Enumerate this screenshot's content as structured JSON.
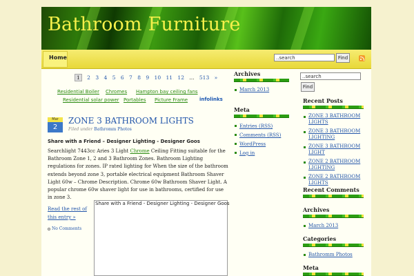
{
  "header": {
    "site_title": "Bathroom Furniture"
  },
  "nav": {
    "home": "Home",
    "search_value": "..search",
    "find_label": "Find"
  },
  "pager": [
    "1",
    "2",
    "3",
    "4",
    "5",
    "6",
    "7",
    "8",
    "9",
    "10",
    "11",
    "12",
    "...",
    "513",
    "»"
  ],
  "link_units": {
    "row1": [
      "Residential Boiler",
      "Chromes",
      "Hampton bay ceiling fans"
    ],
    "row2": [
      "Residential solar power",
      "Portables",
      "Picture Frame"
    ],
    "infolinks": "infolinks"
  },
  "post": {
    "date_month": "Mar",
    "date_day": "2",
    "title": "ZONE 3 BATHROOM LIGHTS",
    "filed_prefix": "Filed under",
    "category": "Bathromm Photos",
    "subhead": "Share with a Friend – Designer Lighting - Designer Goos",
    "body_before": "Searchlight 7443cc Aries 3 Light ",
    "body_link": "Chrome",
    "body_after": " Ceiling Fitting suitable for the Bathroom Zone 1, 2 and 3 Bathroom Zones. Bathroom Lighting regulations for zones. IP rated lighting for When the size of the bathroom extends beyond zone 3, portable electrical equipment Bathroom Shaver Light 60w – Chrome Description. Chrome 60w Bathroom Shaver Light. A popular chrome 60w shaver light for use in bathrooms, certified for use in zone 3.",
    "read_more": "Read the rest of this entry »",
    "comments": "No Comments",
    "frame_text": "Share with a Friend - Designer Lighting - Designer Goos"
  },
  "left_sidebar": {
    "archives_title": "Archives",
    "archives": [
      "March 2013"
    ],
    "meta_title": "Meta",
    "meta": [
      "Entries (RSS)",
      "Comments (RSS)",
      "WordPress",
      "Log in"
    ]
  },
  "right_sidebar": {
    "search_value": "..search",
    "find_label": "Find",
    "recent_posts_title": "Recent Posts",
    "recent_posts": [
      "ZONE 3 BATHROOM LIGHTS",
      "ZONE 3 BATHROOM LIGHTING",
      "ZONE 3 BATHROOM LIGHT",
      "ZONE 2 BATHROOM LIGHTING",
      "ZONE 2 BATHROOM LIGHTS"
    ],
    "recent_comments_title": "Recent Comments",
    "archives_title": "Archives",
    "archives": [
      "March 2013"
    ],
    "categories_title": "Categories",
    "categories": [
      "Bathromm Photos"
    ],
    "meta_title": "Meta"
  },
  "colors": {
    "title_yellow": "#f5f04a",
    "link_blue": "#2255aa",
    "link_green": "#2a8a10",
    "nav_yellow": "#f6ec72"
  }
}
